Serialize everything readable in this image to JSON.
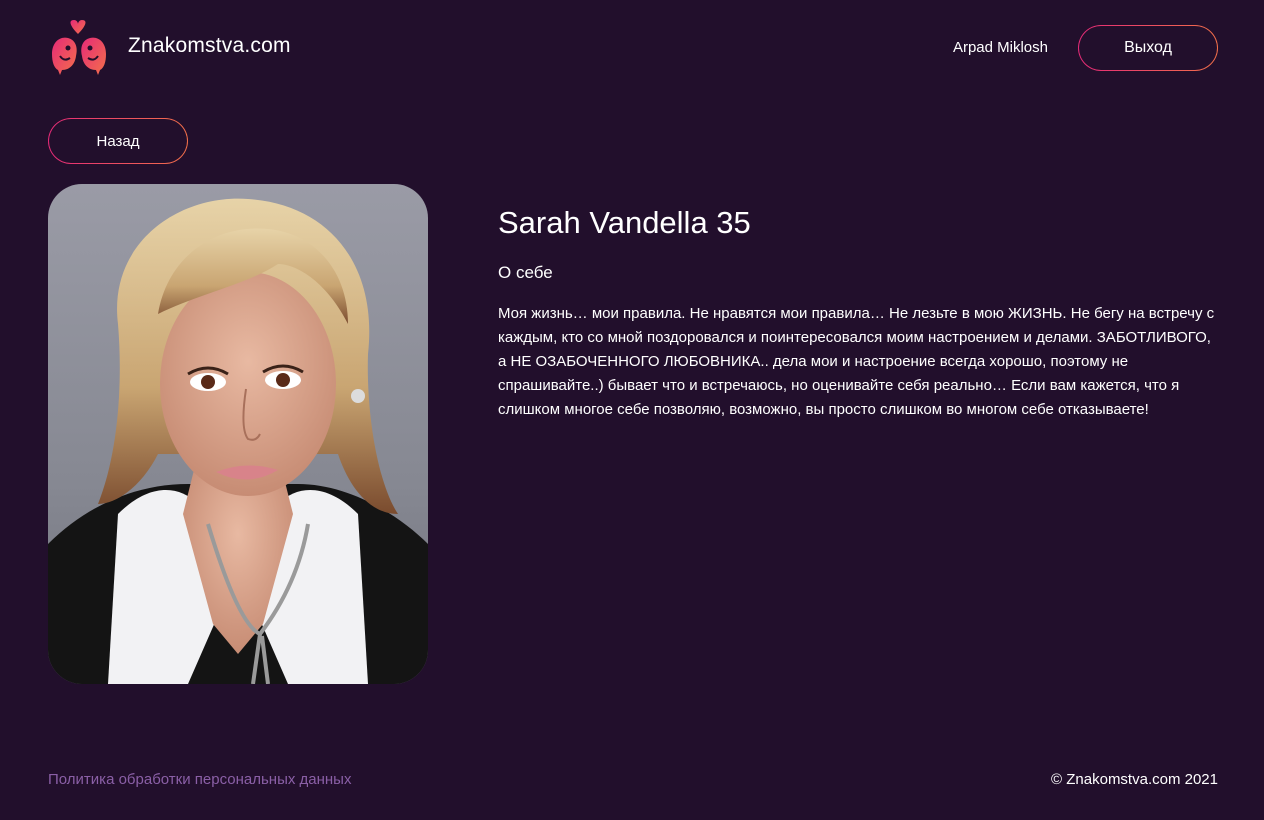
{
  "header": {
    "site_name": "Znakomstva.com",
    "user_name": "Arpad Miklosh",
    "logout_label": "Выход",
    "logo_icon": "two-birds-heart-icon"
  },
  "nav": {
    "back_label": "Назад"
  },
  "profile": {
    "name_age": "Sarah Vandella 35",
    "about_title": "О себе",
    "about_text": "Моя жизнь… мои правила. Не нравятся мои правила… Не лезьте в мою ЖИЗНЬ. Не бегу на встречу с каждым, кто со мной поздоровался и поинтересовался моим настроением и делами. ЗАБОТЛИВОГО, а НЕ ОЗАБОЧЕННОГО ЛЮБОВНИКА.. дела мои и настроение всегда хорошо, поэтому не спрашивайте..) бывает что и встречаюсь, но оценивайте себя реально… Если вам кажется, что я слишком многое себе позволяю, возможно, вы просто слишком во многом себе отказываете!"
  },
  "footer": {
    "privacy_label": "Политика обработки персональных данных",
    "copyright": "© Znakomstva.com 2021"
  },
  "colors": {
    "background": "#220f2c",
    "accent_start": "#e62a78",
    "accent_end": "#f3704a",
    "link": "#8a5fa6"
  }
}
